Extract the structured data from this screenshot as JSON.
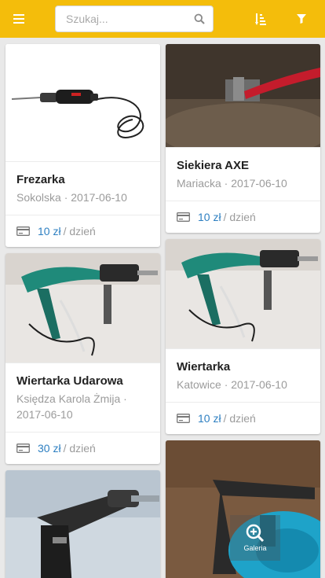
{
  "search": {
    "placeholder": "Szukaj..."
  },
  "colors": {
    "accent": "#f4bd0b",
    "price": "#2d7fc1"
  },
  "icons": {
    "menu": "menu-icon",
    "search": "search-icon",
    "sort": "sort-icon",
    "filter": "filter-icon",
    "price": "card-icon",
    "gallery": "zoom-plus-icon"
  },
  "items": [
    {
      "title": "Frezarka",
      "meta": "Sokolska · 2017-06-10",
      "price": "10 zł",
      "per": "/ dzień"
    },
    {
      "title": "Siekiera AXE",
      "meta": "Mariacka · 2017-06-10",
      "price": "10 zł",
      "per": "/ dzień"
    },
    {
      "title": "Wiertarka Udarowa",
      "meta": "Księdza Karola Żmija · 2017-06-10",
      "price": "30 zł",
      "per": "/ dzień"
    },
    {
      "title": "Wiertarka",
      "meta": "Katowice · 2017-06-10",
      "price": "10 zł",
      "per": "/ dzień"
    }
  ],
  "gallery": {
    "label": "Galeria"
  }
}
